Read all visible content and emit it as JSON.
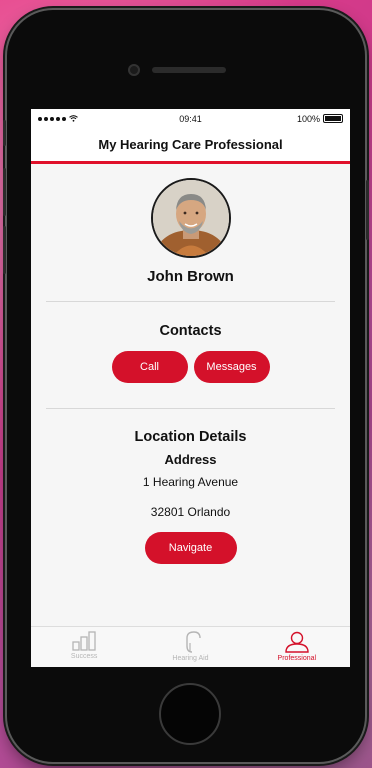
{
  "statusbar": {
    "time": "09:41",
    "battery": "100%"
  },
  "navbar": {
    "title": "My Hearing Care Professional"
  },
  "profile": {
    "name": "John Brown"
  },
  "contacts": {
    "title": "Contacts",
    "call_label": "Call",
    "messages_label": "Messages"
  },
  "location": {
    "title": "Location Details",
    "address_heading": "Address",
    "street": "1 Hearing Avenue",
    "city": "32801 Orlando",
    "navigate_label": "Navigate"
  },
  "tabbar": {
    "items": [
      {
        "label": "Success",
        "icon": "bar-chart-icon"
      },
      {
        "label": "Hearing Aid",
        "icon": "hearing-aid-icon"
      },
      {
        "label": "Professional",
        "icon": "person-icon"
      }
    ],
    "active": "Professional"
  },
  "colors": {
    "accent": "#d4112a",
    "background": "#f6f6f6",
    "inactive_tab": "#b5b5b5"
  }
}
